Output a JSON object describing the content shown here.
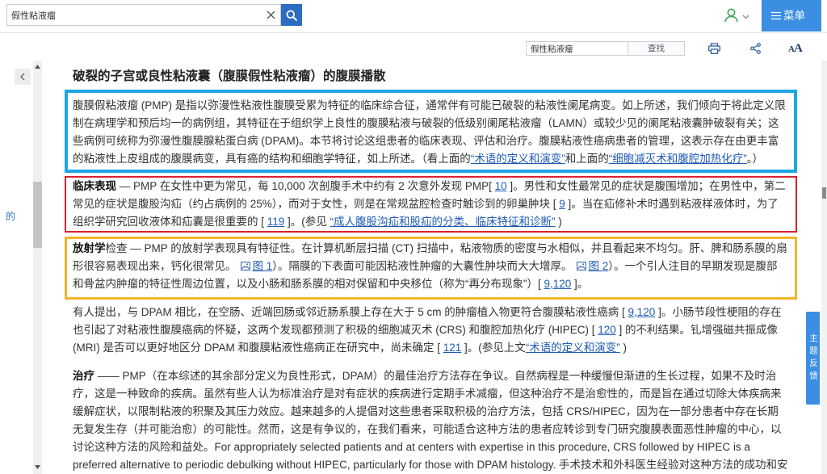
{
  "search": {
    "value": "假性粘液瘤",
    "clear_icon": "close-icon",
    "submit_icon": "search-icon"
  },
  "header": {
    "user_icon": "user-icon",
    "user_menu_icon": "chevron-down-icon",
    "menu_icon": "hamburger-icon",
    "menu_label": "菜单"
  },
  "toolbar": {
    "find_value": "假性粘液瘤",
    "find_label": "查找",
    "print_icon": "print-icon",
    "share_icon": "share-icon",
    "font_size_icon": "font-size-icon",
    "font_glyph_small": "A",
    "font_glyph_large": "A"
  },
  "sidebar": {
    "collapse_icon": "chevron-left-icon",
    "toc_fragment": "的",
    "scroll_up_icon": "scroll-up-icon",
    "scroll_down_icon": "scroll-down-icon"
  },
  "feedback_tab": {
    "label": "主题反馈"
  },
  "article": {
    "heading": "破裂的子宫或良性粘液囊（腹膜假性粘液瘤）的腹膜播散",
    "figure_icon": "image-icon",
    "p1": [
      "腹膜假粘液瘤 (PMP) 是指以弥漫性粘液性腹膜受累为特征的临床综合征，通常伴有可能已破裂的粘液性阑尾病变。如上所述，我们倾向于将此定义限制在病理学和预后均一的病例组，其特征在于组织学上良性的腹膜粘液与破裂的低级别阑尾粘液瘤（LAMN）或较少见的阑尾粘液囊肿破裂有关；这些病例可统称为弥漫性腹膜腺粘蛋白病 (DPAM)。本节将讨论这组患者的临床表现、评估和治疗。腹膜粘液性癌病患者的管理，这表示存在由更丰富的粘液性上皮组成的腹膜病变，具有癌的结构和细胞学特征，如上所述。（看上面的",
      "“术语的定义和演变”",
      "和上面的",
      "“细胞减灭术和腹腔加热化疗”",
      "。）"
    ],
    "p2": [
      "临床表现",
      " — PMP 在女性中更为常见，每 10,000 次剖腹手术中约有 2 次意外发现 PMP[ ",
      "10",
      " ]。男性和女性最常见的症状是腹围增加；在男性中，第二常见的症状是腹股沟疝（约占病例的 25%），而对于女性，则是在常规盆腔检查时触诊到的卵巢肿块 [ ",
      "9",
      " ]。当在疝修补术时遇到粘液样液体时，为了组织学研究回收液体和疝囊是很重要的 [ ",
      "119",
      " ]。(参见 ",
      "“成人腹股沟疝和股疝的分类、临床特征和诊断”",
      " )"
    ],
    "p3": [
      "放射学",
      "检查 — PMP 的放射学表现具有特征性。在计算机断层扫描 (CT) 扫描中，粘液物质的密度与水相似，并且看起来不均匀。肝、脾和肠系膜的扇形很容易表现出来，钙化很常见。",
      "图 1",
      "）。隔膜的下表面可能因粘液性肿瘤的大囊性肿块而大大增厚。",
      "图 2",
      "）。一个引人注目的早期发现是腹部和骨盆内肿瘤的特征性周边位置，以及小肠和肠系膜的相对保留和中央移位（称为“再分布现象”）[ ",
      "9,120",
      " ]。"
    ],
    "p4": [
      "有人提出，与 DPAM 相比，在空肠、近端回肠或邻近肠系膜上存在大于 5 cm 的肿瘤植入物更符合腹膜粘液性癌病 [ ",
      "9,120",
      " ]。小肠节段性梗阻的存在也引起了对粘液性腹膜癌病的怀疑，这两个发现都预测了积极的细胞减灭术 (CRS) 和腹腔加热化疗 (HIPEC) [ ",
      "120",
      " ] 的不利结果。钆增强磁共振成像 (MRI) 是否可以更好地区分 DPAM 和腹膜粘液性癌病正在研究中，尚未确定 [ ",
      "121",
      " ]。(参见上文",
      "“术语的定义和演变”",
      " )"
    ],
    "p5": [
      "治疗",
      " —— PMP（在本综述的其余部分定义为良性形式，DPAM）的最佳治疗方法存在争议。自然病程是一种缓慢但渐进的生长过程，如果不及时治疗，这是一种致命的疾病。虽然有些人认为标准治疗是对有症状的疾病进行定期手术减瘤，但这种治疗不是治愈性的，而是旨在通过切除大体疾病来缓解症状，以限制粘液的积聚及其压力效应。越来越多的人提倡对这些患者采取积极的治疗方法，包括 CRS/HIPEC，因为在一部分患者中存在长期无复发生存（并可能治愈）的可能性。然而，这是有争议的，在我们看来，可能适合这种方法的患者应转诊到专门研究腹膜表面恶性肿瘤的中心，以讨论这种方法的风险和益处。For appropriately selected patients and at centers with expertise in this procedure, CRS followed by HIPEC is a preferred alternative to periodic debulking without HIPEC, particularly for those with DPAM histology. 手术技术和外科医生经验对这种方法的成功和安全的重要性怎么强调都不"
    ]
  },
  "colors": {
    "accent": "#2d6cc1",
    "menu": "#3b8ee2",
    "link": "#1f5bb3",
    "user_icon": "#3aa655",
    "toolbar_icon": "#2f5d9a",
    "box_intro": "#1ca6e6",
    "box_clinical": "#d8232d",
    "box_imaging": "#f2b42a"
  }
}
